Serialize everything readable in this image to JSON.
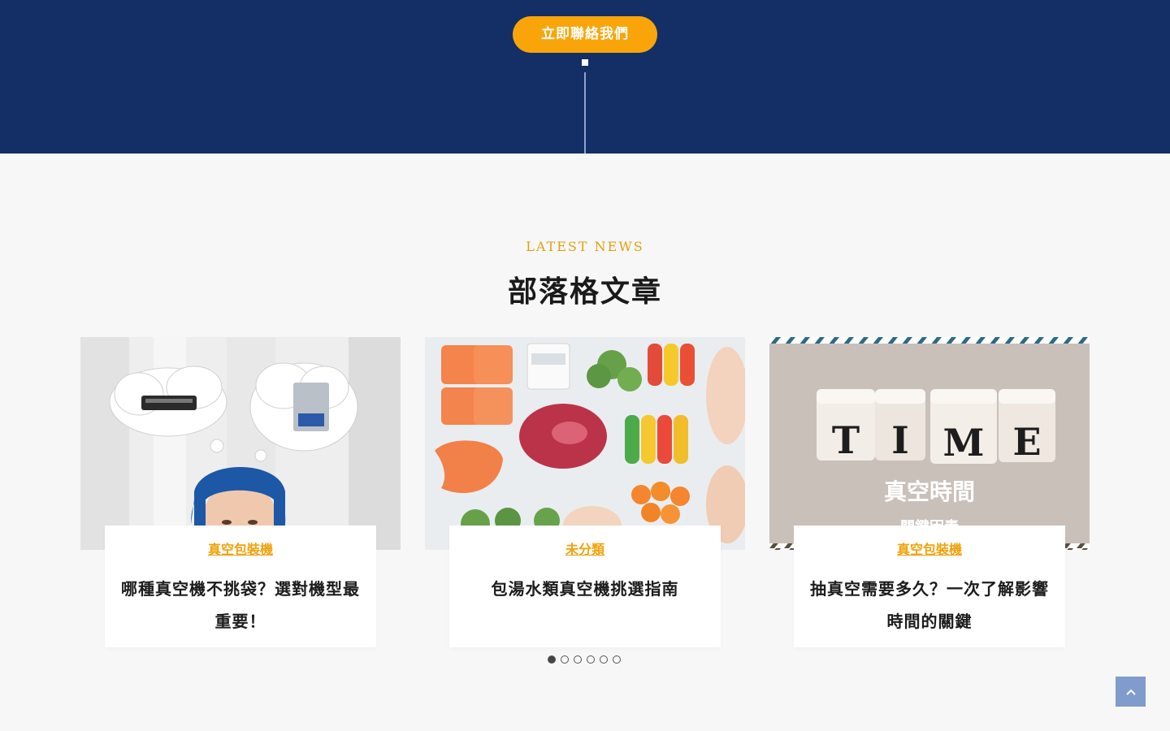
{
  "hero": {
    "cta_label": "立即聯絡我們"
  },
  "section": {
    "eyebrow": "LATEST NEWS",
    "title": "部落格文章"
  },
  "posts": [
    {
      "category": "真空包裝機",
      "title": "哪種真空機不挑袋？選對機型最重要！",
      "image": "woman-thinking-vacuum-machines"
    },
    {
      "category": "未分類",
      "title": "包湯水類真空機挑選指南",
      "image": "vacuum-packed-food"
    },
    {
      "category": "真空包裝機",
      "title": "抽真空需要多久？一次了解影響時間的關鍵",
      "image": "time-blocks",
      "image_caption": "真空時間",
      "image_subcaption": "關鍵因素"
    }
  ],
  "pager": {
    "count": 6,
    "active": 1
  },
  "colors": {
    "navy": "#132f66",
    "accent": "#f9a50a",
    "category": "#f0a20c",
    "to_top": "#7f9ccc"
  },
  "icons": {
    "to_top": "chevron-up-icon"
  }
}
